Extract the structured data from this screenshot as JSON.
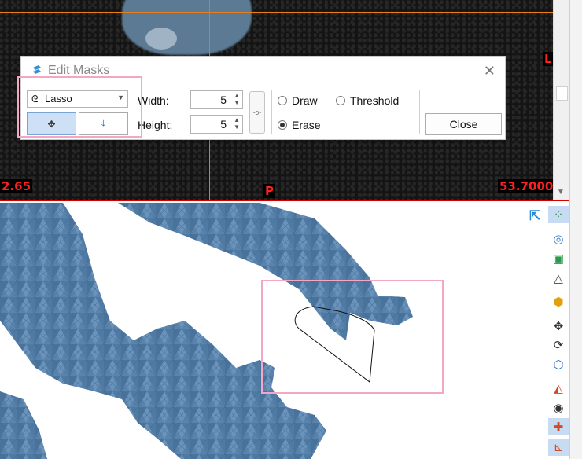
{
  "slice_view": {
    "labels": {
      "left": "2.65",
      "bottom": "P",
      "right": "53.7000",
      "top_right": "L"
    }
  },
  "dialog": {
    "title": "Edit Masks",
    "tool_select": {
      "value": "Lasso"
    },
    "width": {
      "label": "Width:",
      "value": "5"
    },
    "height": {
      "label": "Height:",
      "value": "5"
    },
    "modes": [
      {
        "label": "Draw",
        "selected": false
      },
      {
        "label": "Threshold",
        "selected": false
      },
      {
        "label": "Erase",
        "selected": true
      }
    ],
    "close_label": "Close"
  },
  "icons": {
    "app": "app-logo-icon",
    "close": "close-icon",
    "lasso": "lasso-icon",
    "move": "move-arrows-icon",
    "fill": "fill-bucket-icon",
    "link": "link-icon"
  },
  "toolbar_icons": [
    "grid-dots-icon",
    "circles-icon",
    "cube-green-icon",
    "triangle-icon",
    "hexagon-icon",
    "move-icon",
    "rotate-icon",
    "cube-icon",
    "stack-icon",
    "eye-icon",
    "crosshair-icon",
    "axes-icon"
  ],
  "colors": {
    "mesh": "#5b84ad",
    "mesh_dark": "#3e668e",
    "highlight": "#f2a7c4",
    "crosshair_h": "#e6801a",
    "crosshair_v": "#38c838",
    "border_red": "#d40000"
  }
}
